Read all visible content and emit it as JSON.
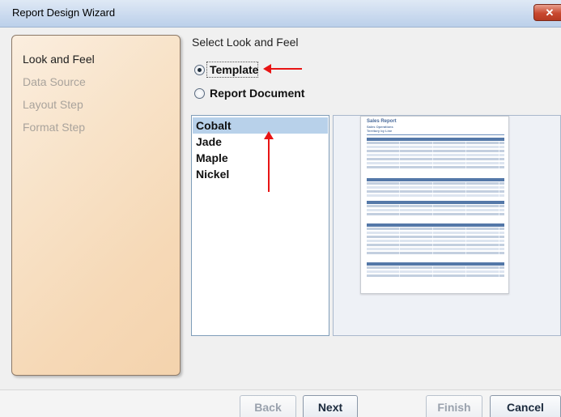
{
  "window": {
    "title": "Report Design Wizard",
    "close_glyph": "✕"
  },
  "steps": [
    {
      "label": "Look and Feel",
      "active": true
    },
    {
      "label": "Data Source",
      "active": false
    },
    {
      "label": "Layout Step",
      "active": false
    },
    {
      "label": "Format Step",
      "active": false
    }
  ],
  "main": {
    "section_label": "Select Look and Feel",
    "options": [
      {
        "label": "Template",
        "selected": true
      },
      {
        "label": "Report Document",
        "selected": false
      }
    ],
    "templates": [
      "Cobalt",
      "Jade",
      "Maple",
      "Nickel"
    ],
    "selected_template": "Cobalt"
  },
  "preview": {
    "title": "Sales Report",
    "subtitle1": "Sales Operations",
    "subtitle2": "Territory by Line"
  },
  "annotations": {
    "arrow_color": "#e81414"
  },
  "buttons": {
    "back": "Back",
    "next": "Next",
    "finish": "Finish",
    "cancel": "Cancel"
  }
}
